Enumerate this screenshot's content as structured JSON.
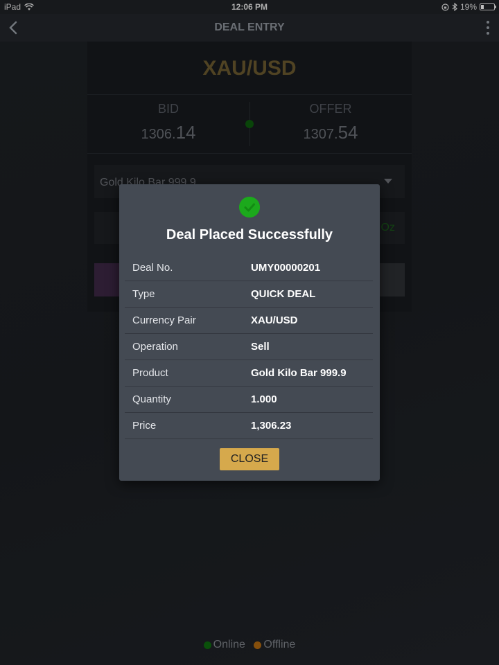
{
  "status_bar": {
    "device": "iPad",
    "time": "12:06 PM",
    "battery": "19%"
  },
  "nav": {
    "title": "DEAL ENTRY"
  },
  "page": {
    "pair": "XAU/USD",
    "bid": {
      "label": "BID",
      "price_main": "1306.",
      "price_big": "14"
    },
    "offer": {
      "label": "OFFER",
      "price_main": "1307.",
      "price_big": "54"
    },
    "product": "Gold Kilo Bar 999.9",
    "unit": "Oz"
  },
  "legend": {
    "online": "Online",
    "offline": "Offline",
    "online_color": "#0e6b0e",
    "offline_color": "#b26a10"
  },
  "dialog": {
    "title": "Deal Placed Successfully",
    "rows": [
      {
        "label": "Deal No.",
        "value": "UMY00000201"
      },
      {
        "label": "Type",
        "value": "QUICK DEAL"
      },
      {
        "label": "Currency Pair",
        "value": "XAU/USD"
      },
      {
        "label": "Operation",
        "value": "Sell"
      },
      {
        "label": "Product",
        "value": "Gold Kilo Bar 999.9"
      },
      {
        "label": "Quantity",
        "value": "1.000"
      },
      {
        "label": "Price",
        "value": "1,306.23"
      }
    ],
    "close_label": "CLOSE",
    "accent": "#d6a94c",
    "success_color": "#1ca91c"
  },
  "icons": {
    "back": "chevron-left-icon",
    "more": "more-vertical-icon",
    "success": "check-circle-icon",
    "wifi": "wifi-icon",
    "lock": "rotation-lock-icon",
    "bluetooth": "bluetooth-icon",
    "battery": "battery-icon"
  }
}
